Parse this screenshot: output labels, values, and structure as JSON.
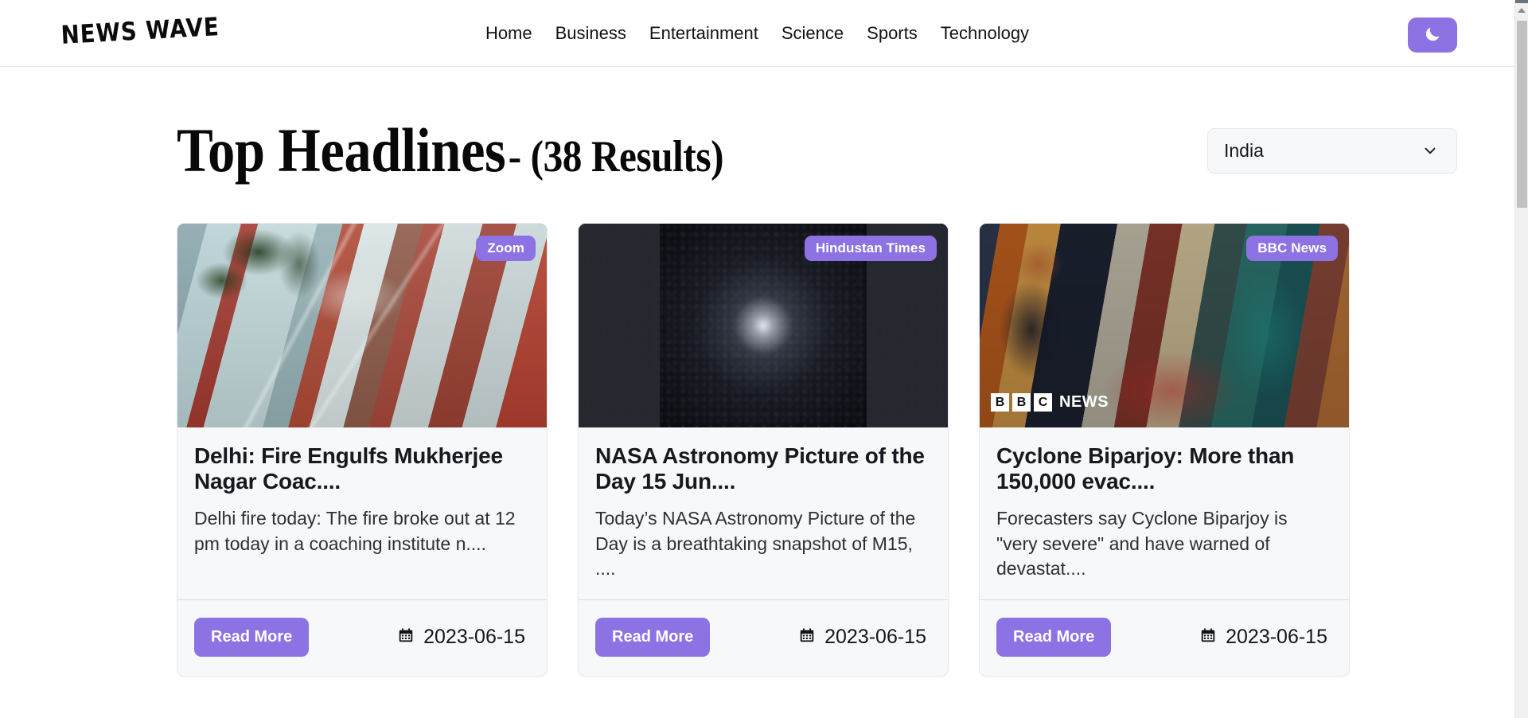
{
  "header": {
    "brand": "NEWS WAVE",
    "nav_items": [
      {
        "label": "Home"
      },
      {
        "label": "Business"
      },
      {
        "label": "Entertainment"
      },
      {
        "label": "Science"
      },
      {
        "label": "Sports"
      },
      {
        "label": "Technology"
      }
    ],
    "theme_toggle": {
      "icon": "moon-icon",
      "color": "#8c72e3"
    }
  },
  "main": {
    "title_main": "Top Headlines",
    "title_results": "- (38 Results)",
    "result_count": 38,
    "country_select": {
      "value": "India",
      "icon": "chevron-down-icon",
      "options": [
        "India"
      ]
    },
    "cards": [
      {
        "source": "Zoom",
        "title": "Delhi: Fire Engulfs Mukherjee Nagar Coac....",
        "description": "Delhi fire today: The fire broke out at 12 pm today in a coaching institute n....",
        "read_more": "Read More",
        "date": "2023-06-15",
        "date_icon": "calendar-icon",
        "image": "delhi-fire-building-photo",
        "watermark": null
      },
      {
        "source": "Hindustan Times",
        "title": "NASA Astronomy Picture of the Day 15 Jun....",
        "description": "Today’s NASA Astronomy Picture of the Day is a breathtaking snapshot of M15, ....",
        "read_more": "Read More",
        "date": "2023-06-15",
        "date_icon": "calendar-icon",
        "image": "globular-star-cluster-m15-photo",
        "watermark": null
      },
      {
        "source": "BBC News",
        "title": "Cyclone Biparjoy: More than 150,000 evac....",
        "description": "Forecasters say Cyclone Biparjoy is \"very severe\" and have warned of devastat....",
        "read_more": "Read More",
        "date": "2023-06-15",
        "date_icon": "calendar-icon",
        "image": "cyclone-biparjoy-evacuees-photo",
        "watermark": {
          "letters": [
            "B",
            "B",
            "C"
          ],
          "word": "NEWS"
        }
      }
    ]
  },
  "colors": {
    "accent": "#8c72e3",
    "card_bg": "#f7f8fa",
    "page_bg": "#ffffff",
    "text": "#16191d"
  }
}
